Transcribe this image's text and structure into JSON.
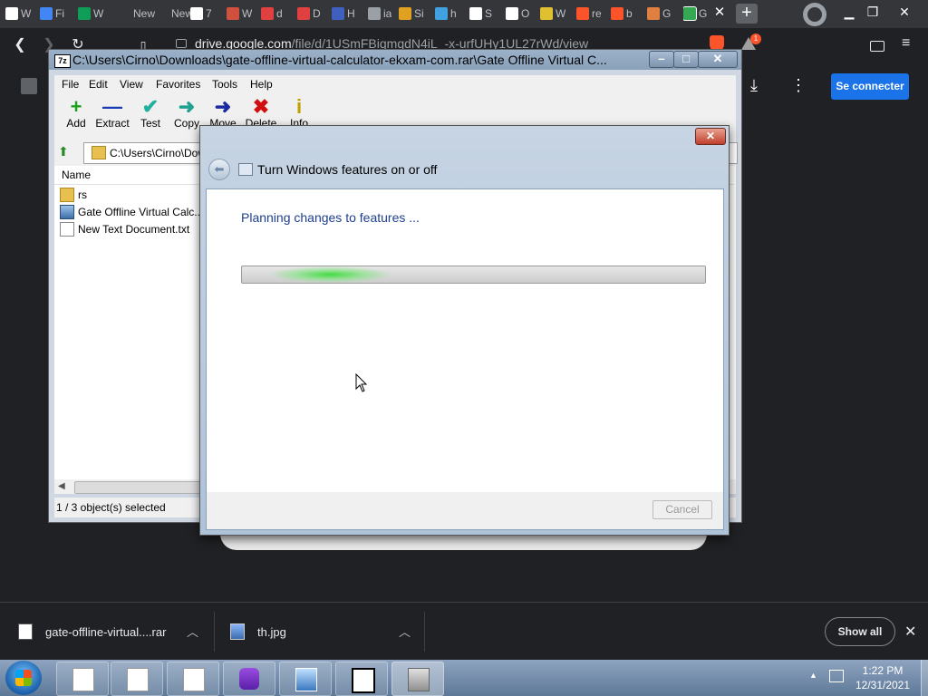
{
  "browser": {
    "tabs": [
      {
        "label": "W",
        "icon": "wikipedia-icon",
        "color": "#ffffff"
      },
      {
        "label": "Fi",
        "icon": "docs-icon",
        "color": "#4285f4"
      },
      {
        "label": "W",
        "icon": "sheets-icon",
        "color": "#0f9d58"
      },
      {
        "label": "New",
        "icon": "new-tab-icon",
        "color": "#35363a"
      },
      {
        "label": "New",
        "icon": "new-tab-icon",
        "color": "#35363a"
      },
      {
        "label": "7",
        "icon": "7zip-icon",
        "color": "#ffffff"
      },
      {
        "label": "W",
        "icon": "page-icon",
        "color": "#d05040"
      },
      {
        "label": "d",
        "icon": "page-icon",
        "color": "#e04040"
      },
      {
        "label": "D",
        "icon": "page-icon",
        "color": "#e04040"
      },
      {
        "label": "H",
        "icon": "file-icon",
        "color": "#4060c0"
      },
      {
        "label": "ia",
        "icon": "globe-icon",
        "color": "#9aa0a6"
      },
      {
        "label": "Si",
        "icon": "colorful-icon",
        "color": "#e0a020"
      },
      {
        "label": "h",
        "icon": "colorful-icon",
        "color": "#40a0e0"
      },
      {
        "label": "S",
        "icon": "github-icon",
        "color": "#ffffff"
      },
      {
        "label": "O",
        "icon": "wix-icon",
        "color": "#ffffff"
      },
      {
        "label": "W",
        "icon": "w-icon",
        "color": "#e0c030"
      },
      {
        "label": "re",
        "icon": "brave-icon",
        "color": "#fb542b"
      },
      {
        "label": "b",
        "icon": "brave-icon",
        "color": "#fb542b"
      },
      {
        "label": "G",
        "icon": "tag-icon",
        "color": "#e08040"
      },
      {
        "label": "G",
        "icon": "drive-icon",
        "color": "#34a853"
      }
    ],
    "url_host": "drive.google.com",
    "url_path": "/file/d/1USmFBiqmqdN4iL_-x-urfUHy1UL27rWd/view",
    "rewards_count": "1",
    "signin_label": "Se connecter"
  },
  "zip": {
    "title": "C:\\Users\\Cirno\\Downloads\\gate-offline-virtual-calculator-ekxam-com.rar\\Gate Offline Virtual C...",
    "app_icon": "7z",
    "menus": [
      "File",
      "Edit",
      "View",
      "Favorites",
      "Tools",
      "Help"
    ],
    "toolbar": [
      {
        "label": "Add",
        "glyph": "+",
        "color": "#1aa01a"
      },
      {
        "label": "Extract",
        "glyph": "—",
        "color": "#1a3ab8"
      },
      {
        "label": "Test",
        "glyph": "✔",
        "color": "#20b0a0"
      },
      {
        "label": "Copy",
        "glyph": "➜",
        "color": "#20a090"
      },
      {
        "label": "Move",
        "glyph": "➜",
        "color": "#1a2aa0"
      },
      {
        "label": "Delete",
        "glyph": "✖",
        "color": "#d01010"
      },
      {
        "label": "Info",
        "glyph": "i",
        "color": "#c0a000"
      }
    ],
    "address": "C:\\Users\\Cirno\\Dow",
    "column_name": "Name",
    "files": [
      {
        "name": "rs",
        "type": "folder"
      },
      {
        "name": "Gate Offline Virtual Calc...",
        "type": "app"
      },
      {
        "name": "New Text Document.txt",
        "type": "text"
      }
    ],
    "status": "1 / 3 object(s) selected"
  },
  "dialog": {
    "title": "Turn Windows features on or off",
    "heading": "Planning changes to features ...",
    "progress_state": "indeterminate",
    "cancel_label": "Cancel"
  },
  "downloads": {
    "items": [
      {
        "name": "gate-offline-virtual....rar"
      },
      {
        "name": "th.jpg"
      }
    ],
    "show_all_label": "Show all"
  },
  "taskbar": {
    "time": "1:22 PM",
    "date": "12/31/2021",
    "apps": [
      "notepad",
      "notepad",
      "notepad",
      "brave",
      "image-viewer",
      "7zip",
      "windows-features"
    ]
  }
}
